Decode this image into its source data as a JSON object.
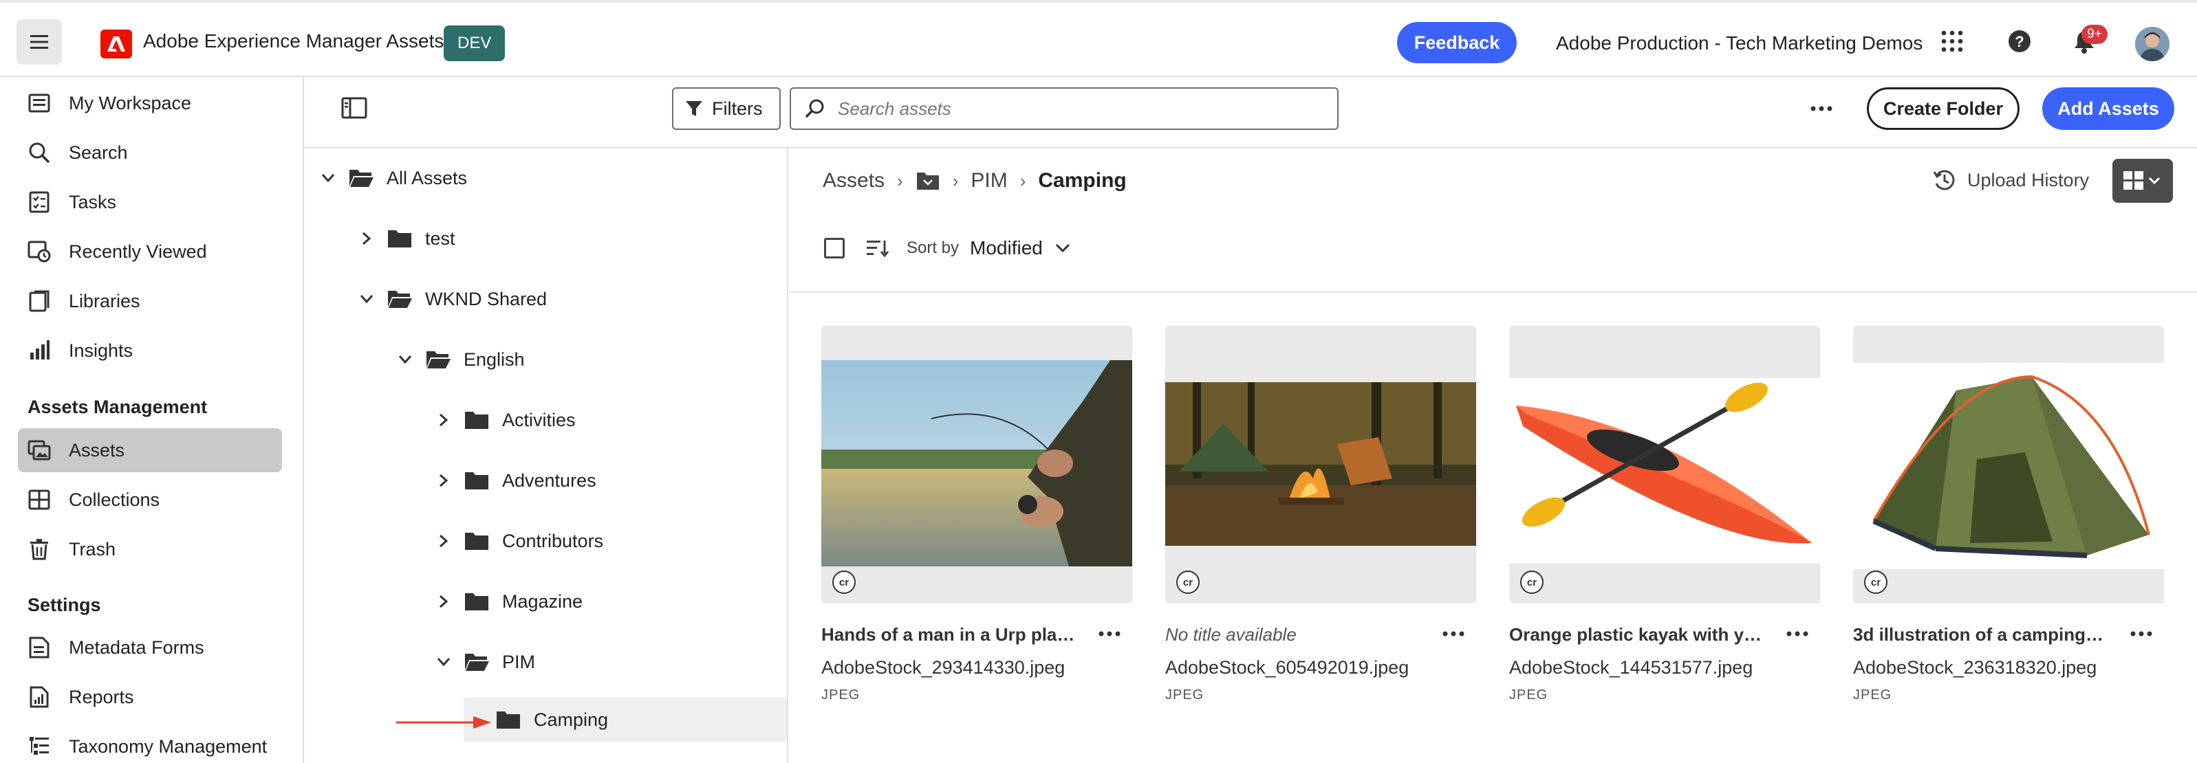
{
  "header": {
    "app_name": "Adobe Experience Manager Assets",
    "env_badge": "DEV",
    "feedback_label": "Feedback",
    "org_name": "Adobe Production - Tech Marketing Demos",
    "notification_count": "9+",
    "icons": [
      "menu-icon",
      "adobe-logo-icon",
      "apps-grid-icon",
      "help-icon",
      "bell-icon",
      "avatar"
    ]
  },
  "sidebar": {
    "items": [
      {
        "label": "My Workspace",
        "icon": "workspace-icon"
      },
      {
        "label": "Search",
        "icon": "search-icon"
      },
      {
        "label": "Tasks",
        "icon": "tasks-icon"
      },
      {
        "label": "Recently Viewed",
        "icon": "recent-icon"
      },
      {
        "label": "Libraries",
        "icon": "libraries-icon"
      },
      {
        "label": "Insights",
        "icon": "insights-icon"
      }
    ],
    "section_assets": "Assets Management",
    "assets_items": [
      {
        "label": "Assets",
        "icon": "assets-icon",
        "active": true
      },
      {
        "label": "Collections",
        "icon": "collections-icon"
      },
      {
        "label": "Trash",
        "icon": "trash-icon"
      }
    ],
    "section_settings": "Settings",
    "settings_items": [
      {
        "label": "Metadata Forms",
        "icon": "metadata-forms-icon"
      },
      {
        "label": "Reports",
        "icon": "reports-icon"
      },
      {
        "label": "Taxonomy Management",
        "icon": "taxonomy-icon"
      }
    ]
  },
  "toolbar": {
    "filters_label": "Filters",
    "search_placeholder": "Search assets",
    "create_folder_label": "Create Folder",
    "add_assets_label": "Add Assets"
  },
  "tree": {
    "nodes": [
      {
        "label": "All Assets",
        "expanded": true
      },
      {
        "label": "test",
        "expanded": false
      },
      {
        "label": "WKND Shared",
        "expanded": true
      },
      {
        "label": "English",
        "expanded": true
      },
      {
        "label": "Activities",
        "expanded": false
      },
      {
        "label": "Adventures",
        "expanded": false
      },
      {
        "label": "Contributors",
        "expanded": false
      },
      {
        "label": "Magazine",
        "expanded": false
      },
      {
        "label": "PIM",
        "expanded": true
      },
      {
        "label": "Camping",
        "selected": true
      }
    ]
  },
  "main": {
    "breadcrumb": [
      "Assets",
      "PIM",
      "Camping"
    ],
    "upload_history_label": "Upload History",
    "sort_by_label": "Sort by",
    "sort_value": "Modified",
    "assets": [
      {
        "title": "Hands of a man in a Urp plan...",
        "filename": "AdobeStock_293414330.jpeg",
        "type": "JPEG",
        "badge": "cr"
      },
      {
        "title": "No title available",
        "filename": "AdobeStock_605492019.jpeg",
        "type": "JPEG",
        "badge": "cr",
        "no_title": true
      },
      {
        "title": "Orange plastic kayak with ye...",
        "filename": "AdobeStock_144531577.jpeg",
        "type": "JPEG",
        "badge": "cr"
      },
      {
        "title": "3d illustration of a camping t...",
        "filename": "AdobeStock_236318320.jpeg",
        "type": "JPEG",
        "badge": "cr"
      }
    ]
  },
  "colors": {
    "accent_blue": "#3b63fb",
    "dev_badge": "#2d6e6a",
    "adobe_red": "#eb1000",
    "pointer_arrow": "#e8412c"
  }
}
